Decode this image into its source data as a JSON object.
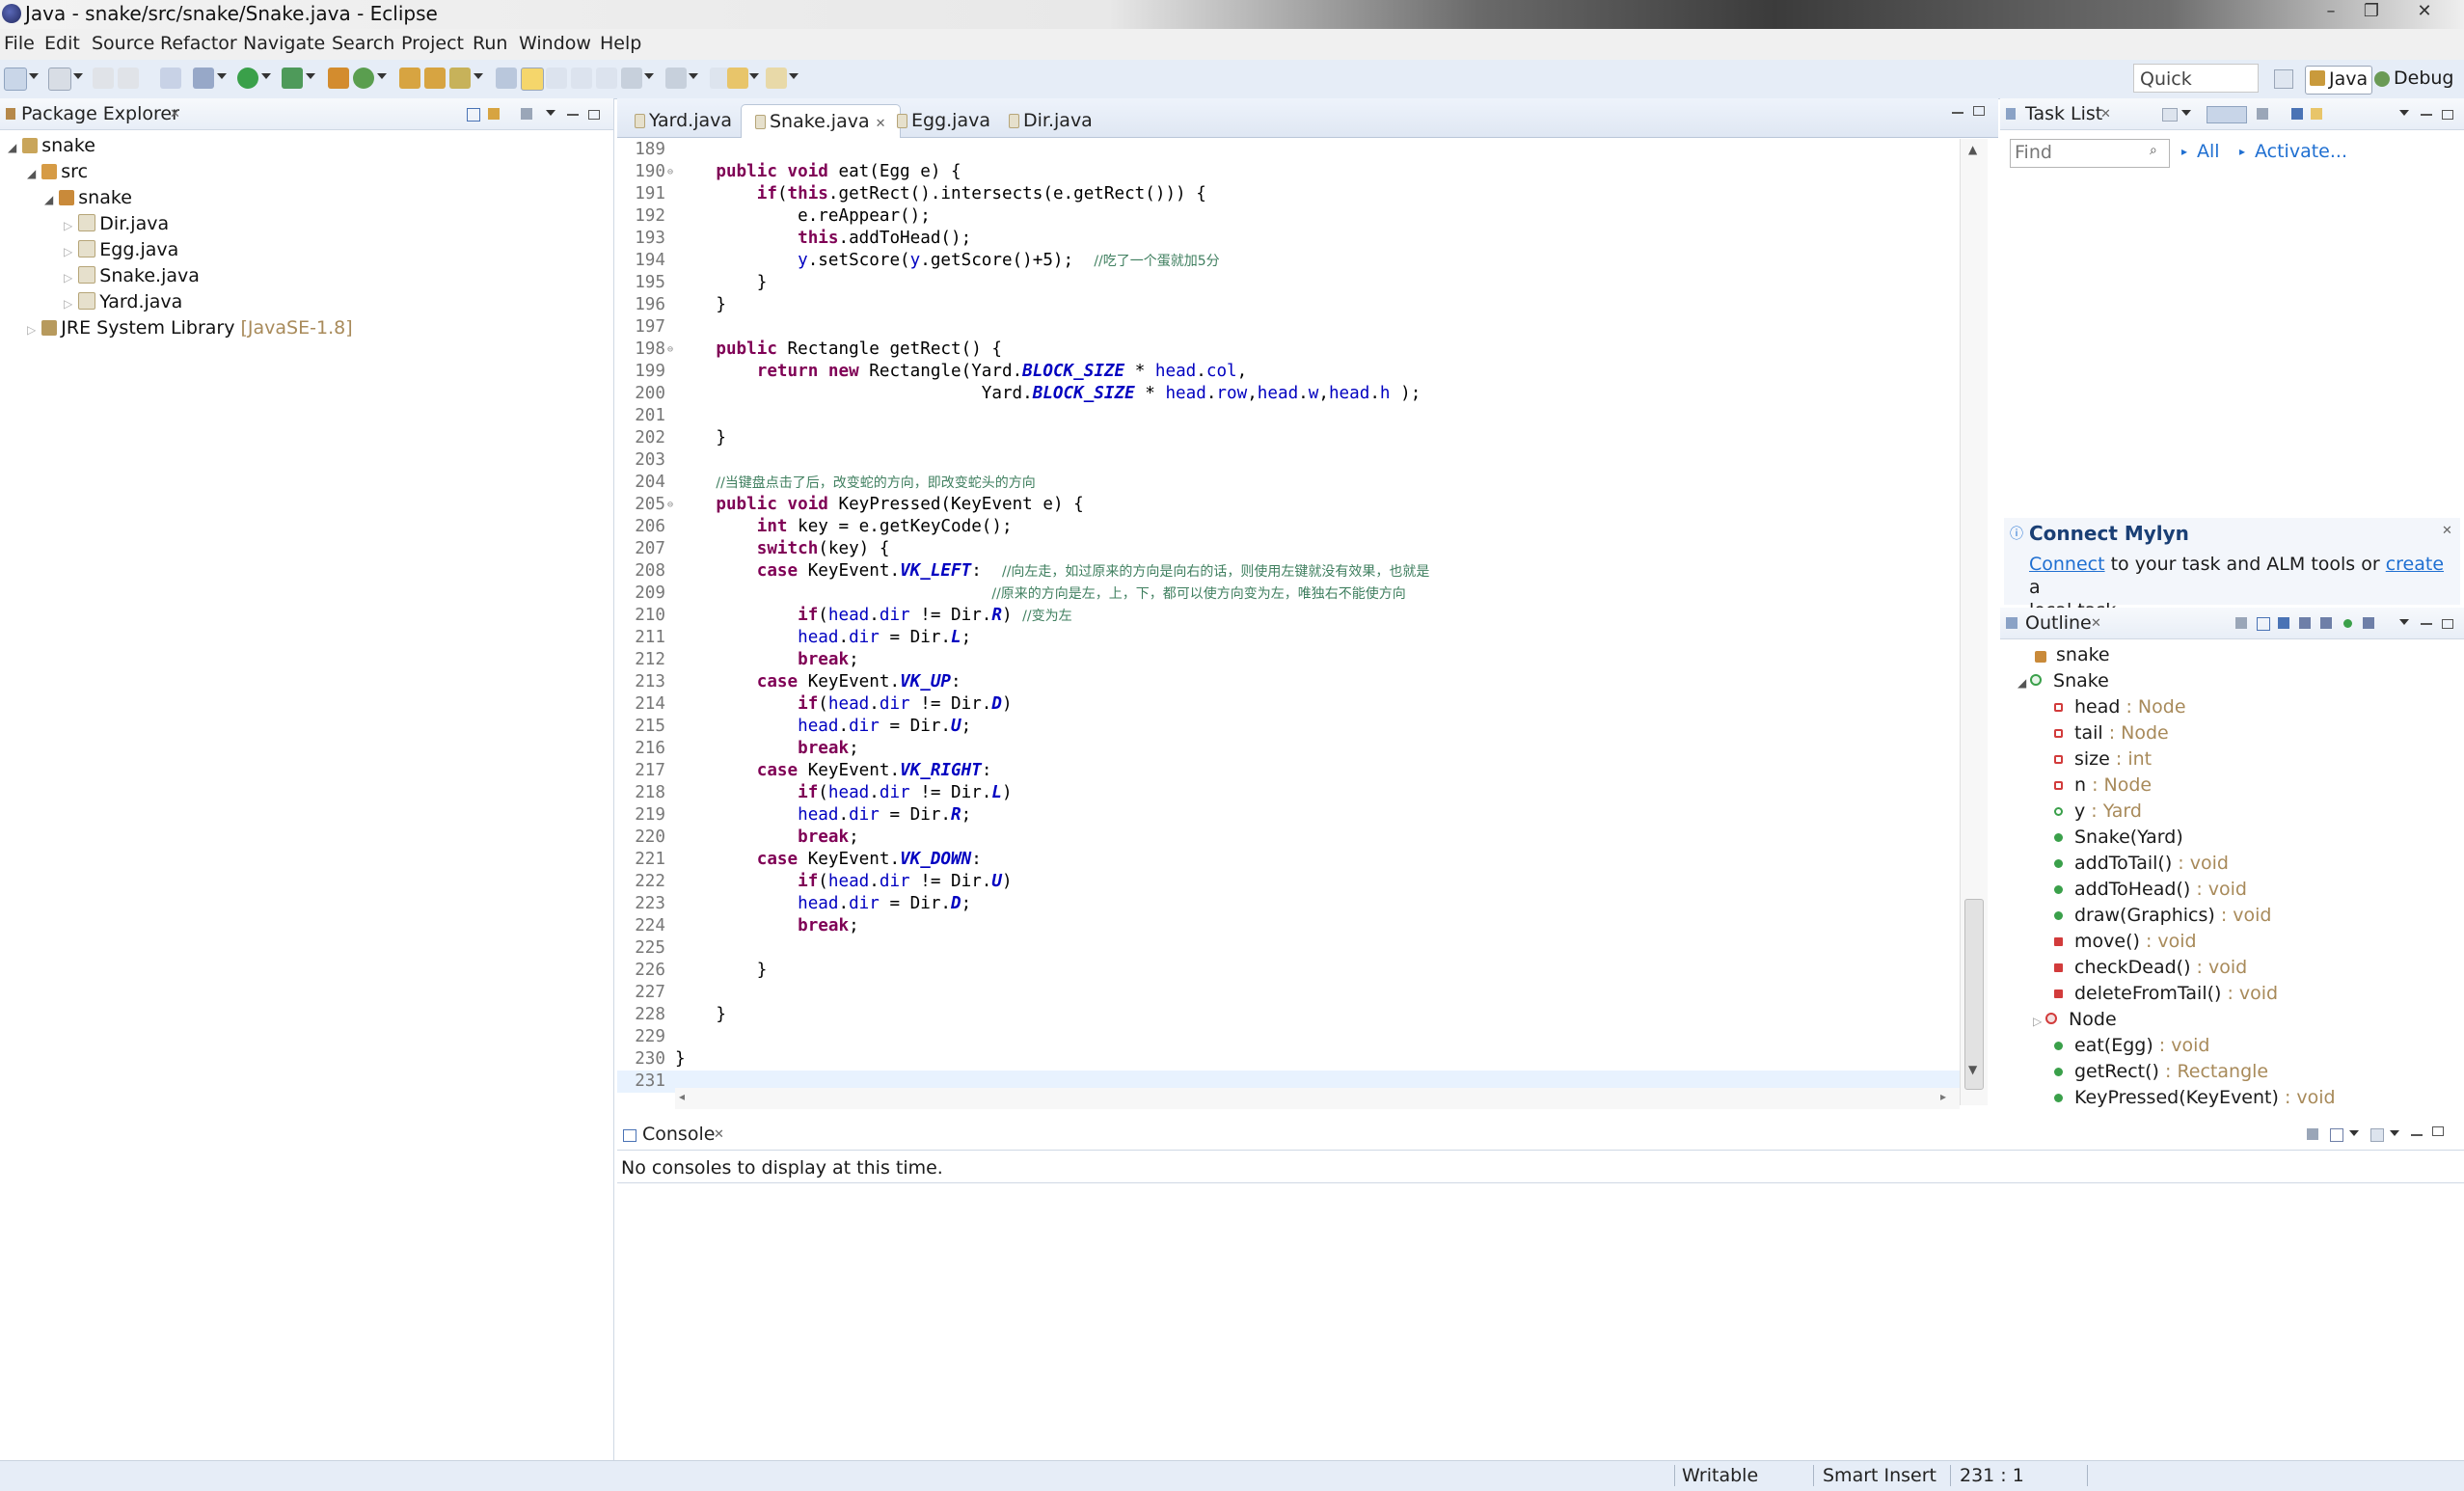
{
  "window": {
    "title": "Java - snake/src/snake/Snake.java - Eclipse"
  },
  "menu": [
    "File",
    "Edit",
    "Source",
    "Refactor",
    "Navigate",
    "Search",
    "Project",
    "Run",
    "Window",
    "Help"
  ],
  "toolbar": {
    "quick_access": "Quick Access",
    "perspective_java": "Java",
    "perspective_debug": "Debug"
  },
  "package_explorer": {
    "title": "Package Explorer",
    "items": [
      {
        "label": "snake",
        "depth": 0
      },
      {
        "label": "src",
        "depth": 1
      },
      {
        "label": "snake",
        "depth": 2
      },
      {
        "label": "Dir.java",
        "depth": 3
      },
      {
        "label": "Egg.java",
        "depth": 3
      },
      {
        "label": "Snake.java",
        "depth": 3
      },
      {
        "label": "Yard.java",
        "depth": 3
      },
      {
        "label": "JRE System Library",
        "suffix": "[JavaSE-1.8]",
        "depth": 1
      }
    ]
  },
  "editor": {
    "tabs": [
      "Yard.java",
      "Snake.java",
      "Egg.java",
      "Dir.java"
    ],
    "active_tab": "Snake.java",
    "lines": [
      {
        "n": "189",
        "html": ""
      },
      {
        "n": "190",
        "html": "    <span class='kw'>public</span> <span class='kw'>void</span> eat(Egg e) {"
      },
      {
        "n": "191",
        "html": "        <span class='kw'>if</span>(<span class='kw'>this</span>.getRect().intersects(e.getRect())) {"
      },
      {
        "n": "192",
        "html": "            e.reAppear();"
      },
      {
        "n": "193",
        "html": "            <span class='kw'>this</span>.addToHead();"
      },
      {
        "n": "194",
        "html": "            <span class='fld'>y</span>.setScore(<span class='fld'>y</span>.getScore()+5);  <span class='cmt'>//吃了一个蛋就加5分</span>"
      },
      {
        "n": "195",
        "html": "        }"
      },
      {
        "n": "196",
        "html": "    }"
      },
      {
        "n": "197",
        "html": ""
      },
      {
        "n": "198",
        "html": "    <span class='kw'>public</span> Rectangle getRect() {"
      },
      {
        "n": "199",
        "html": "        <span class='kw'>return</span> <span class='kw'>new</span> Rectangle(Yard.<span class='sfld'>BLOCK_SIZE</span> * <span class='fld'>head</span>.<span class='fld'>col</span>,"
      },
      {
        "n": "200",
        "html": "                              Yard.<span class='sfld'>BLOCK_SIZE</span> * <span class='fld'>head</span>.<span class='fld'>row</span>,<span class='fld'>head</span>.<span class='fld'>w</span>,<span class='fld'>head</span>.<span class='fld'>h</span> );"
      },
      {
        "n": "201",
        "html": ""
      },
      {
        "n": "202",
        "html": "    }"
      },
      {
        "n": "203",
        "html": ""
      },
      {
        "n": "204",
        "html": "    <span class='cmt'>//当键盘点击了后，改变蛇的方向，即改变蛇头的方向</span>"
      },
      {
        "n": "205",
        "html": "    <span class='kw'>public</span> <span class='kw'>void</span> KeyPressed(KeyEvent e) {"
      },
      {
        "n": "206",
        "html": "        <span class='kw'>int</span> key = e.getKeyCode();"
      },
      {
        "n": "207",
        "html": "        <span class='kw'>switch</span>(key) {"
      },
      {
        "n": "208",
        "html": "        <span class='kw'>case</span> KeyEvent.<span class='sfld'>VK_LEFT</span>:  <span class='cmt'>//向左走，如过原来的方向是向右的话，则使用左键就没有效果，也就是</span>"
      },
      {
        "n": "209",
        "html": "                               <span class='cmt'>//原来的方向是左，上，下，都可以使方向变为左，唯独右不能使方向</span>"
      },
      {
        "n": "210",
        "html": "            <span class='kw'>if</span>(<span class='fld'>head</span>.<span class='fld'>dir</span> != Dir.<span class='sfld'>R</span>) <span class='cmt'>//变为左</span>"
      },
      {
        "n": "211",
        "html": "            <span class='fld'>head</span>.<span class='fld'>dir</span> = Dir.<span class='sfld'>L</span>;"
      },
      {
        "n": "212",
        "html": "            <span class='kw'>break</span>;"
      },
      {
        "n": "213",
        "html": "        <span class='kw'>case</span> KeyEvent.<span class='sfld'>VK_UP</span>:"
      },
      {
        "n": "214",
        "html": "            <span class='kw'>if</span>(<span class='fld'>head</span>.<span class='fld'>dir</span> != Dir.<span class='sfld'>D</span>)"
      },
      {
        "n": "215",
        "html": "            <span class='fld'>head</span>.<span class='fld'>dir</span> = Dir.<span class='sfld'>U</span>;"
      },
      {
        "n": "216",
        "html": "            <span class='kw'>break</span>;"
      },
      {
        "n": "217",
        "html": "        <span class='kw'>case</span> KeyEvent.<span class='sfld'>VK_RIGHT</span>:"
      },
      {
        "n": "218",
        "html": "            <span class='kw'>if</span>(<span class='fld'>head</span>.<span class='fld'>dir</span> != Dir.<span class='sfld'>L</span>)"
      },
      {
        "n": "219",
        "html": "            <span class='fld'>head</span>.<span class='fld'>dir</span> = Dir.<span class='sfld'>R</span>;"
      },
      {
        "n": "220",
        "html": "            <span class='kw'>break</span>;"
      },
      {
        "n": "221",
        "html": "        <span class='kw'>case</span> KeyEvent.<span class='sfld'>VK_DOWN</span>:"
      },
      {
        "n": "222",
        "html": "            <span class='kw'>if</span>(<span class='fld'>head</span>.<span class='fld'>dir</span> != Dir.<span class='sfld'>U</span>)"
      },
      {
        "n": "223",
        "html": "            <span class='fld'>head</span>.<span class='fld'>dir</span> = Dir.<span class='sfld'>D</span>;"
      },
      {
        "n": "224",
        "html": "            <span class='kw'>break</span>;"
      },
      {
        "n": "225",
        "html": ""
      },
      {
        "n": "226",
        "html": "        }"
      },
      {
        "n": "227",
        "html": ""
      },
      {
        "n": "228",
        "html": "    }"
      },
      {
        "n": "229",
        "html": ""
      },
      {
        "n": "230",
        "html": "}"
      },
      {
        "n": "231",
        "html": ""
      }
    ]
  },
  "task_list": {
    "title": "Task List",
    "find_placeholder": "Find",
    "all": "All",
    "activate": "Activate..."
  },
  "mylyn": {
    "title": "Connect Mylyn",
    "connect": "Connect",
    "text1": " to your task and ALM tools or ",
    "create": "create",
    "text2": " a",
    "text3": "local task."
  },
  "outline": {
    "title": "Outline",
    "items": [
      {
        "name": "snake",
        "type": "",
        "depth": 0,
        "kind": "package"
      },
      {
        "name": "Snake",
        "type": "",
        "depth": 0,
        "kind": "class"
      },
      {
        "name": "head",
        "type": " : Node",
        "depth": 1,
        "kind": "private-field"
      },
      {
        "name": "tail",
        "type": " : Node",
        "depth": 1,
        "kind": "private-field"
      },
      {
        "name": "size",
        "type": " : int",
        "depth": 1,
        "kind": "private-field"
      },
      {
        "name": "n",
        "type": " : Node",
        "depth": 1,
        "kind": "private-field"
      },
      {
        "name": "y",
        "type": " : Yard",
        "depth": 1,
        "kind": "package-field"
      },
      {
        "name": "Snake(Yard)",
        "type": "",
        "depth": 1,
        "kind": "constructor"
      },
      {
        "name": "addToTail()",
        "type": " : void",
        "depth": 1,
        "kind": "public-method"
      },
      {
        "name": "addToHead()",
        "type": " : void",
        "depth": 1,
        "kind": "public-method"
      },
      {
        "name": "draw(Graphics)",
        "type": " : void",
        "depth": 1,
        "kind": "public-method"
      },
      {
        "name": "move()",
        "type": " : void",
        "depth": 1,
        "kind": "private-method"
      },
      {
        "name": "checkDead()",
        "type": " : void",
        "depth": 1,
        "kind": "private-method"
      },
      {
        "name": "deleteFromTail()",
        "type": " : void",
        "depth": 1,
        "kind": "private-method"
      },
      {
        "name": "Node",
        "type": "",
        "depth": 1,
        "kind": "inner-class"
      },
      {
        "name": "eat(Egg)",
        "type": " : void",
        "depth": 1,
        "kind": "public-method"
      },
      {
        "name": "getRect()",
        "type": " : Rectangle",
        "depth": 1,
        "kind": "public-method"
      },
      {
        "name": "KeyPressed(KeyEvent)",
        "type": " : void",
        "depth": 1,
        "kind": "public-method"
      }
    ]
  },
  "console": {
    "title": "Console",
    "message": "No consoles to display at this time."
  },
  "status": {
    "writable": "Writable",
    "insert_mode": "Smart Insert",
    "position": "231 : 1"
  },
  "colors": {
    "accent": "#1f6fd1",
    "keyword": "#7f0055",
    "field": "#0000c0",
    "comment": "#3f7f5f"
  }
}
